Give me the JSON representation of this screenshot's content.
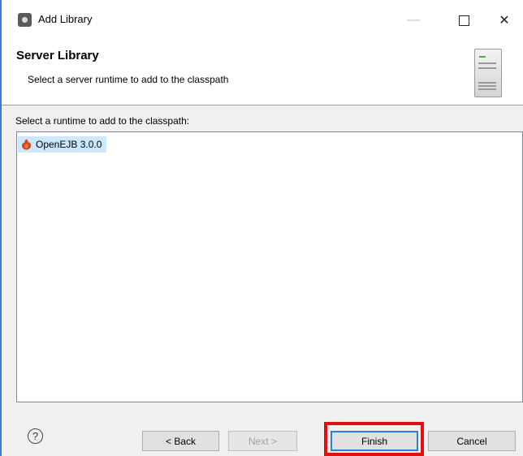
{
  "window": {
    "title": "Add Library",
    "controls": {
      "minimize": "—",
      "maximize": "",
      "close": "✕"
    }
  },
  "banner": {
    "title": "Server Library",
    "subtitle": "Select a server runtime to add to the classpath",
    "image": "server-icon"
  },
  "runtimes": {
    "label": "Select a runtime to add to the classpath:",
    "items": [
      {
        "label": "OpenEJB 3.0.0",
        "icon": "openejb-icon",
        "selected": true
      }
    ]
  },
  "footer": {
    "help": "?",
    "back_label": "< Back",
    "next_label": "Next >",
    "finish_label": "Finish",
    "cancel_label": "Cancel"
  },
  "colors": {
    "selection": "#cce8ff",
    "highlight": "#e01010",
    "default_button_border": "#2a7fd6"
  }
}
